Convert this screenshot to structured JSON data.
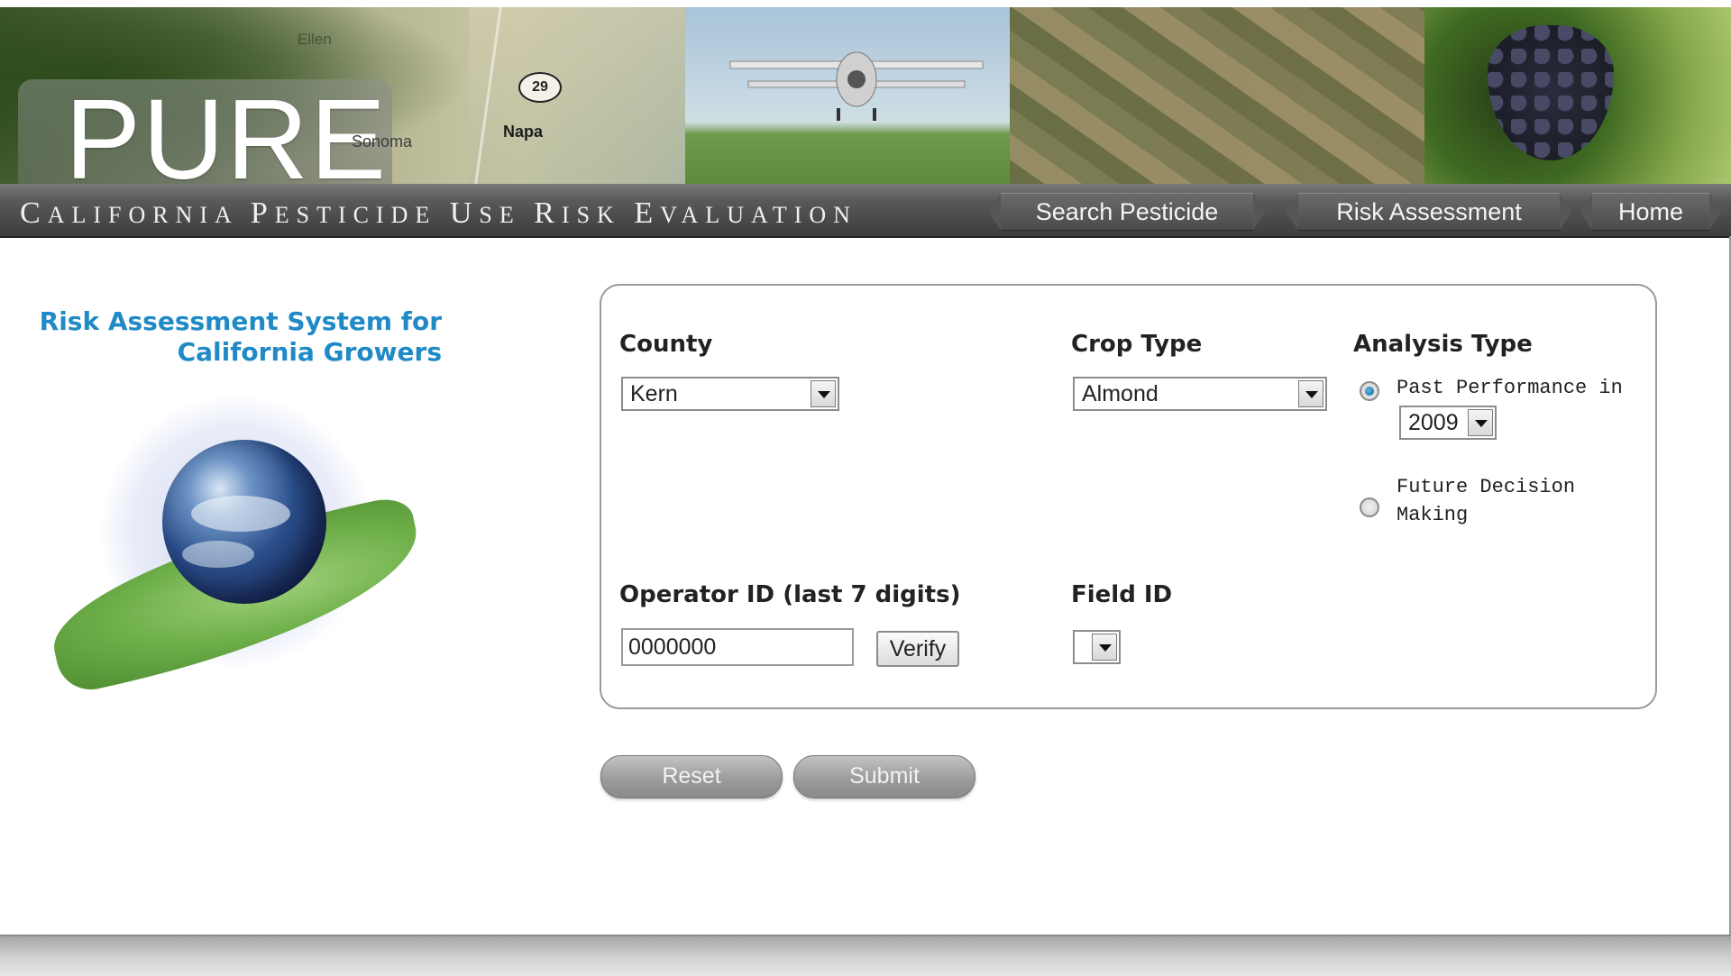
{
  "banner": {
    "logo_text": "PURE",
    "map_labels": {
      "route": "29",
      "napa": "Napa",
      "sonoma": "Sonoma",
      "ellen": "Ellen"
    }
  },
  "nav": {
    "tagline": [
      "California",
      "Pesticide",
      "Use",
      "Risk",
      "Evaluation"
    ],
    "buttons": {
      "search": "Search Pesticide",
      "risk": "Risk Assessment",
      "home": "Home"
    }
  },
  "sidebar": {
    "title_line1": "Risk Assessment System for",
    "title_line2": "California Growers"
  },
  "form": {
    "county": {
      "label": "County",
      "value": "Kern"
    },
    "crop": {
      "label": "Crop Type",
      "value": "Almond"
    },
    "analysis": {
      "label": "Analysis Type",
      "options": [
        {
          "label": "Past Performance in",
          "checked": true
        },
        {
          "label_line1": "Future Decision",
          "label_line2": "Making",
          "checked": false
        }
      ],
      "year": "2009"
    },
    "operator": {
      "label": "Operator ID (last 7 digits)",
      "value": "0000000",
      "verify_label": "Verify"
    },
    "field": {
      "label": "Field ID",
      "value": ""
    }
  },
  "actions": {
    "reset": "Reset",
    "submit": "Submit"
  },
  "colors": {
    "accent": "#1f8ac6",
    "nav_bg": "#4a4a4a",
    "button_gray": "#9c9c9c"
  }
}
